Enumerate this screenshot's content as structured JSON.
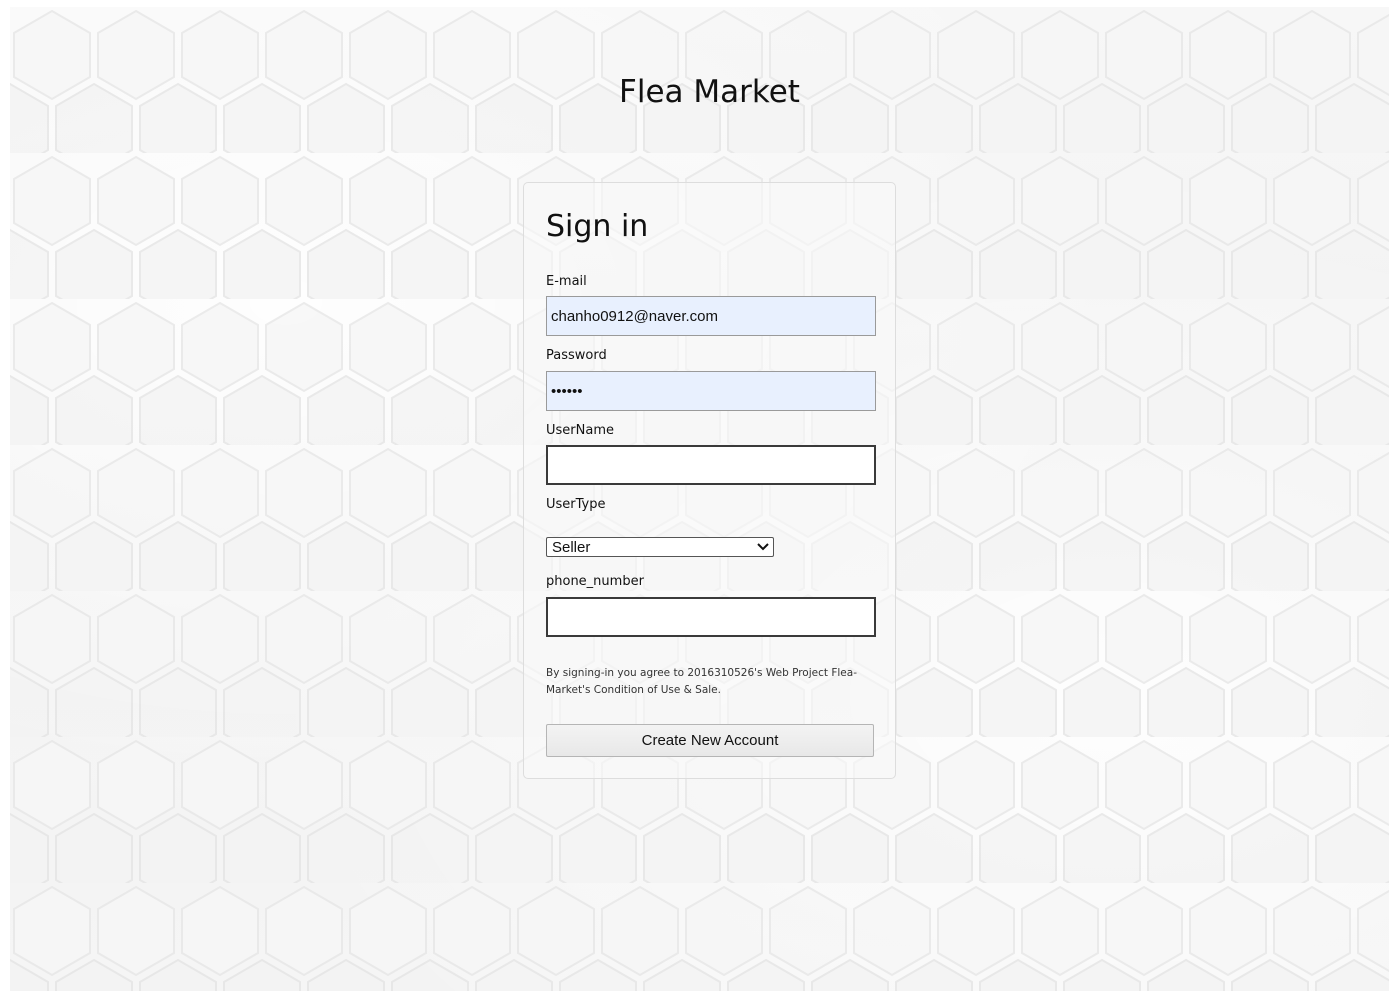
{
  "site": {
    "title": "Flea Market"
  },
  "form": {
    "heading": "Sign in",
    "email": {
      "label": "E-mail",
      "value": "chanho0912@naver.com"
    },
    "password": {
      "label": "Password",
      "value": "••••••"
    },
    "username": {
      "label": "UserName",
      "value": ""
    },
    "usertype": {
      "label": "UserType",
      "selected": "Seller"
    },
    "phone": {
      "label": "phone_number",
      "value": ""
    },
    "agreement": "By signing-in you agree to 2016310526's Web Project Flea-Market's Condition of Use & Sale.",
    "submit_label": "Create New Account"
  },
  "icons": {
    "select_arrow": "chevron-down-icon"
  },
  "colors": {
    "autofill_bg": "#e8f0fe",
    "page_bg": "#f4f4f4",
    "text": "#111111"
  }
}
